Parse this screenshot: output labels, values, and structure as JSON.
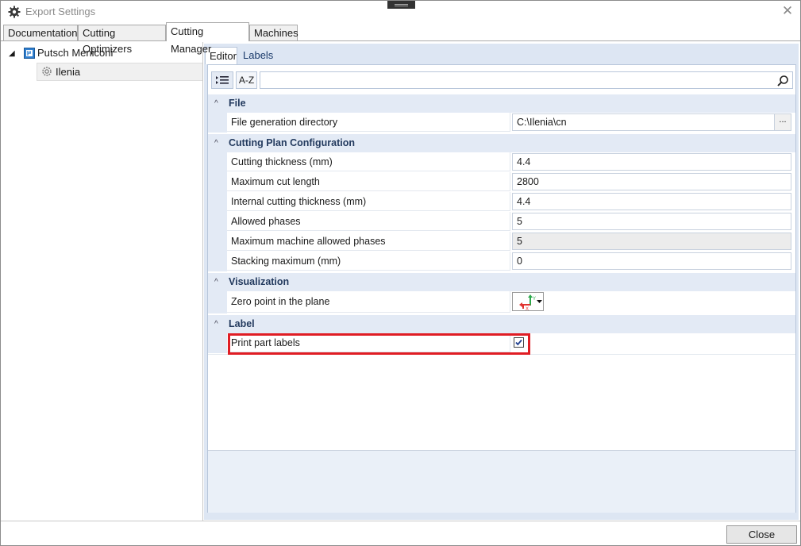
{
  "window": {
    "title": "Export Settings"
  },
  "tabs": [
    {
      "label": "Documentation"
    },
    {
      "label": "Cutting Optimizers"
    },
    {
      "label": "Cutting Manager"
    },
    {
      "label": "Machines"
    }
  ],
  "tree": {
    "root": {
      "label": "Putsch Meniconi"
    },
    "child": {
      "label": "Ilenia"
    }
  },
  "editor": {
    "tabs": [
      {
        "label": "Editor"
      },
      {
        "label": "Labels"
      }
    ],
    "toolbar": {
      "az_label": "A-Z",
      "search_value": ""
    },
    "categories": {
      "file": "File",
      "cutting": "Cutting Plan Configuration",
      "visualization": "Visualization",
      "label": "Label"
    },
    "file": {
      "generation_dir": {
        "name": "File generation directory",
        "value": "C:\\Ilenia\\cn",
        "browse": "..."
      }
    },
    "cutting": {
      "thickness": {
        "name": "Cutting thickness (mm)",
        "value": "4.4"
      },
      "max_cut_length": {
        "name": "Maximum cut length",
        "value": "2800"
      },
      "internal_thickness": {
        "name": "Internal cutting thickness (mm)",
        "value": "4.4"
      },
      "allowed_phases": {
        "name": "Allowed phases",
        "value": "5"
      },
      "machine_phases": {
        "name": "Maximum machine allowed phases",
        "value": "5"
      },
      "stacking_max": {
        "name": "Stacking maximum (mm)",
        "value": "0"
      }
    },
    "visualization": {
      "zero_point": {
        "name": "Zero point in the plane",
        "axis_y": "Y",
        "axis_x": "X"
      }
    },
    "label": {
      "print_part_labels": {
        "name": "Print part labels",
        "checked": true
      }
    }
  },
  "footer": {
    "close_label": "Close"
  },
  "colors": {
    "highlight": "#e01d24",
    "category_bg": "#e3eaf5",
    "pane_bg": "#dde6f3"
  }
}
